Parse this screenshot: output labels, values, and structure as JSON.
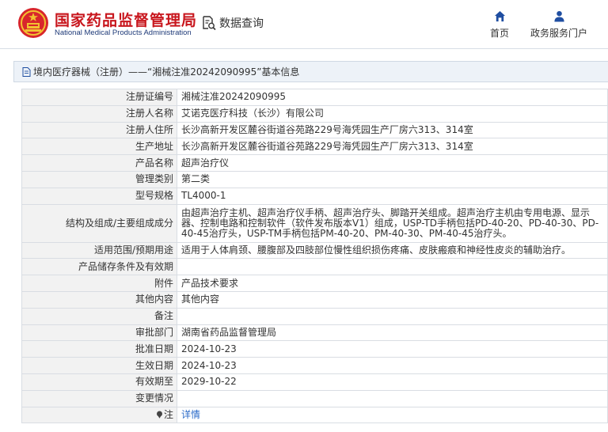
{
  "header": {
    "brand_cn": "国家药品监督管理局",
    "brand_en": "National Medical Products Administration",
    "query_label": "数据查询",
    "nav": {
      "home": "首页",
      "portal": "政务服务门户"
    }
  },
  "breadcrumb": {
    "text": "境内医疗器械（注册）——“湘械注准20242090995”基本信息"
  },
  "fields": [
    {
      "label": "注册证编号",
      "value": "湘械注准20242090995"
    },
    {
      "label": "注册人名称",
      "value": "艾诺克医疗科技（长沙）有限公司"
    },
    {
      "label": "注册人住所",
      "value": "长沙高新开发区麓谷街道谷苑路229号海凭园生产厂房六313、314室"
    },
    {
      "label": "生产地址",
      "value": "长沙高新开发区麓谷街道谷苑路229号海凭园生产厂房六313、314室"
    },
    {
      "label": "产品名称",
      "value": "超声治疗仪"
    },
    {
      "label": "管理类别",
      "value": "第二类"
    },
    {
      "label": "型号规格",
      "value": "TL4000-1"
    },
    {
      "label": "结构及组成/主要组成成分",
      "value": "由超声治疗主机、超声治疗仪手柄、超声治疗头、脚踏开关组成。超声治疗主机由专用电源、显示器、控制电路和控制软件（软件发布版本V1）组成，USP-TD手柄包括PD-40-20、PD-40-30、PD-40-45治疗头，USP-TM手柄包括PM-40-20、PM-40-30、PM-40-45治疗头。"
    },
    {
      "label": "适用范围/预期用途",
      "value": "适用于人体肩颈、腰腹部及四肢部位慢性组织损伤疼痛、皮肤瘢痕和神经性皮炎的辅助治疗。"
    },
    {
      "label": "产品储存条件及有效期",
      "value": ""
    },
    {
      "label": "附件",
      "value": "产品技术要求"
    },
    {
      "label": "其他内容",
      "value": "其他内容"
    },
    {
      "label": "备注",
      "value": ""
    },
    {
      "label": "审批部门",
      "value": "湖南省药品监督管理局"
    },
    {
      "label": "批准日期",
      "value": "2024-10-23"
    },
    {
      "label": "生效日期",
      "value": "2024-10-23"
    },
    {
      "label": "有效期至",
      "value": "2029-10-22"
    },
    {
      "label": "变更情况",
      "value": ""
    },
    {
      "label": "注",
      "value": "详情"
    }
  ]
}
